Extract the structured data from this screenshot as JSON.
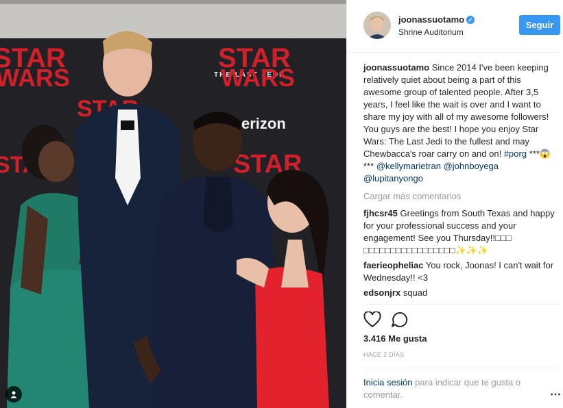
{
  "post": {
    "username": "joonassuotamo",
    "location": "Shrine Auditorium",
    "follow_label": "Seguir",
    "caption_user": "joonassuotamo",
    "caption_text": "Since 2014 I've been keeping relatively quiet about being a part of this awesome group of talented people. After 3,5 years, I feel like the wait is over and I want to share my joy with all of my awesome followers! You guys are the best! I hope you enjoy Star Wars: The Last Jedi to the fullest and may Chewbacca's roar carry on and on!",
    "hashtag": "#porg",
    "stars": "***😱***",
    "mention1": "@kellymarietran",
    "mention2": "@johnboyega",
    "mention3": "@lupitanyongo",
    "load_more": "Cargar más comentarios",
    "comments": [
      {
        "user": "fjhcsr45",
        "text": "Greetings from South Texas and happy for your professional success and your engagement! See you Thursday!!□□□ □□□□□□□□□□□□□□□□□✨✨✨"
      },
      {
        "user": "faerieopheliac",
        "text": "You rock, Joonas! I can't wait for Wednesday!! <3"
      },
      {
        "user": "edsonjrx",
        "text": "squad"
      }
    ],
    "likes": "3.416 Me gusta",
    "time_ago": "HACE 2 DÍAS",
    "login_link": "Inicia sesión",
    "login_text": "para indicar que te gusta o comentar.",
    "more_icon": "⋯"
  },
  "photo": {
    "backdrop_logo_line1": "STAR",
    "backdrop_logo_line2": "THE LAST JEDI",
    "backdrop_logo_line3": "WARS",
    "sponsor": "erizon"
  },
  "colors": {
    "accent": "#3897f0",
    "link": "#003569",
    "muted": "#999999",
    "starwars_red": "#d0202a"
  }
}
